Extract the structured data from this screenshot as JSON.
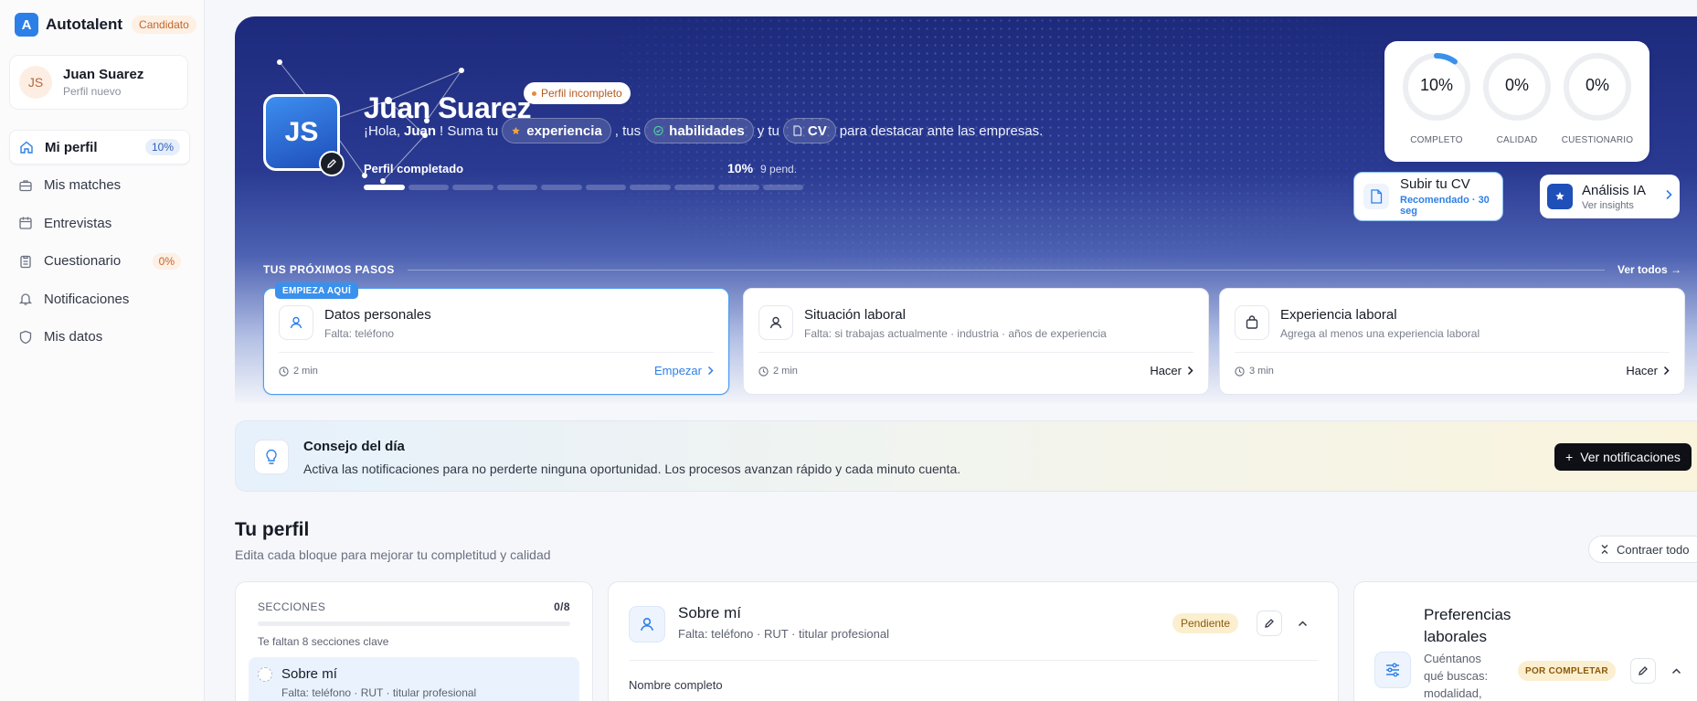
{
  "brand": {
    "name": "Autotalent",
    "logo_letter": "A",
    "role_badge": "Candidato"
  },
  "user": {
    "initials": "JS",
    "name": "Juan Suarez",
    "subtitle": "Perfil nuevo"
  },
  "nav": [
    {
      "label": "Mi perfil",
      "icon": "home-icon",
      "badge": "10%",
      "active": true
    },
    {
      "label": "Mis matches",
      "icon": "briefcase-icon",
      "badge": ""
    },
    {
      "label": "Entrevistas",
      "icon": "calendar-icon",
      "badge": ""
    },
    {
      "label": "Cuestionario",
      "icon": "clipboard-icon",
      "badge": "0%"
    },
    {
      "label": "Notificaciones",
      "icon": "bell-icon",
      "badge": ""
    },
    {
      "label": "Mis datos",
      "icon": "shield-icon",
      "badge": ""
    }
  ],
  "hero": {
    "initials": "JS",
    "name": "Juan Suarez",
    "status": "Perfil incompleto",
    "greeting_prefix": "¡Hola, ",
    "greeting_name": "Juan",
    "greeting_mid": "! Suma tu",
    "chip_experience": "experiencia",
    "sep1": ", tus",
    "chip_skills": "habilidades",
    "sep2": "y tu",
    "chip_cv": "CV",
    "greeting_suffix": "para destacar ante las empresas.",
    "progress_label": "Perfil completado",
    "progress_pct": "10%",
    "progress_pending": "9 pend.",
    "progress_fraction": 0.1,
    "segments_total": 10,
    "segments_done": 1
  },
  "stats": [
    {
      "value": "10%",
      "label": "COMPLETO",
      "fraction": 0.1
    },
    {
      "value": "0%",
      "label": "CALIDAD",
      "fraction": 0
    },
    {
      "value": "0%",
      "label": "CUESTIONARIO",
      "fraction": 0
    }
  ],
  "cv_button": {
    "title": "Subir tu CV",
    "subtitle": "Recomendado · 30 seg"
  },
  "ai_button": {
    "title": "Análisis IA",
    "subtitle": "Ver insights"
  },
  "next_steps": {
    "title": "TUS PRÓXIMOS PASOS",
    "view_all": "Ver todos →",
    "items": [
      {
        "ribbon": "EMPIEZA AQUÍ",
        "title": "Datos personales",
        "subtitle": "Falta: teléfono",
        "time": "2 min",
        "action": "Empezar",
        "icon": "user-icon"
      },
      {
        "ribbon": "",
        "title": "Situación laboral",
        "subtitle": "Falta: si trabajas actualmente · industria · años de experiencia",
        "time": "2 min",
        "action": "Hacer",
        "icon": "person-icon"
      },
      {
        "ribbon": "",
        "title": "Experiencia laboral",
        "subtitle": "Agrega al menos una experiencia laboral",
        "time": "3 min",
        "action": "Hacer",
        "icon": "bag-icon"
      }
    ]
  },
  "tip": {
    "title": "Consejo del día",
    "text": "Activa las notificaciones para no perderte ninguna oportunidad. Los procesos avanzan rápido y cada minuto cuenta.",
    "button": "Ver notificaciones",
    "button_prefix": "+"
  },
  "profile": {
    "title": "Tu perfil",
    "subtitle": "Edita cada bloque para mejorar tu completitud y calidad",
    "collapse_all": "Contraer todo"
  },
  "sections": {
    "heading": "SECCIONES",
    "count": "0/8",
    "note": "Te faltan 8 secciones clave",
    "item_title": "Sobre mí",
    "item_sub": "Falta: teléfono · RUT · titular profesional"
  },
  "about": {
    "title": "Sobre mí",
    "subtitle": "Falta: teléfono · RUT · titular profesional",
    "badge": "Pendiente",
    "field_label": "Nombre completo"
  },
  "preferences": {
    "title": "Preferencias laborales",
    "subtitle": "Cuéntanos qué buscas: modalidad,",
    "badge": "POR COMPLETAR"
  },
  "colors": {
    "accent": "#2d7fe8",
    "hero_top": "#1d2a7c",
    "warning": "#c2672b"
  }
}
